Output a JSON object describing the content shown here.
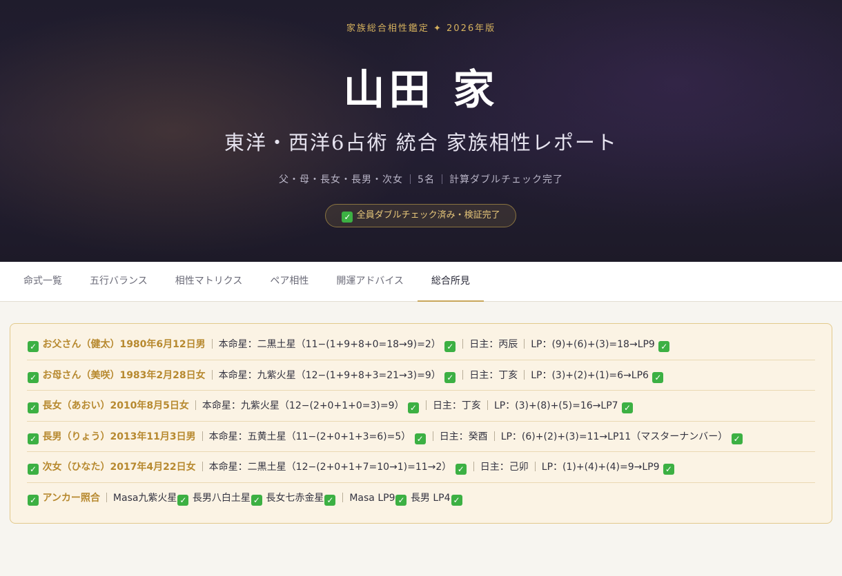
{
  "hero": {
    "eyebrow": "家族総合相性鑑定 ✦ 2026年版",
    "title": "山田 家",
    "subtitle": "東洋・西洋6占術 統合 家族相性レポート",
    "meta": [
      "父・母・長女・長男・次女",
      "5名",
      "計算ダブルチェック完了"
    ],
    "badge": "全員ダブルチェック済み・検証完了"
  },
  "tabs": [
    {
      "label": "命式一覧",
      "active": false
    },
    {
      "label": "五行バランス",
      "active": false
    },
    {
      "label": "相性マトリクス",
      "active": false
    },
    {
      "label": "ペア相性",
      "active": false
    },
    {
      "label": "開運アドバイス",
      "active": false
    },
    {
      "label": "総合所見",
      "active": true
    }
  ],
  "rows": [
    {
      "lead": "お父さん（健太）1980年6月12日男",
      "a": "本命星：二黒土星（11−(1+9+8+0=18→9)=2）",
      "b": "日主：丙辰",
      "c": "LP：(9)+(6)+(3)=18→LP9"
    },
    {
      "lead": "お母さん（美咲）1983年2月28日女",
      "a": "本命星：九紫火星（12−(1+9+8+3=21→3)=9）",
      "b": "日主：丁亥",
      "c": "LP：(3)+(2)+(1)=6→LP6"
    },
    {
      "lead": "長女（あおい）2010年8月5日女",
      "a": "本命星：九紫火星（12−(2+0+1+0=3)=9）",
      "b": "日主：丁亥",
      "c": "LP：(3)+(8)+(5)=16→LP7"
    },
    {
      "lead": "長男（りょう）2013年11月3日男",
      "a": "本命星：五黄土星（11−(2+0+1+3=6)=5）",
      "b": "日主：癸酉",
      "c": "LP：(6)+(2)+(3)=11→LP11（マスターナンバー）"
    },
    {
      "lead": "次女（ひなた）2017年4月22日女",
      "a": "本命星：二黒土星（12−(2+0+1+7=10→1)=11→2）",
      "b": "日主：己卯",
      "c": "LP：(1)+(4)+(4)=9→LP9"
    }
  ],
  "anchor": {
    "lead": "アンカー照合",
    "group1": [
      "Masa九紫火星",
      "長男八白土星",
      "長女七赤金星"
    ],
    "group2": [
      "Masa LP9",
      "長男 LP4"
    ]
  },
  "colors": {
    "accent": "#c9a65a",
    "check": "#3cb043",
    "hero_bg": "#1f1c2c",
    "panel_bg": "#fbf3e4"
  }
}
